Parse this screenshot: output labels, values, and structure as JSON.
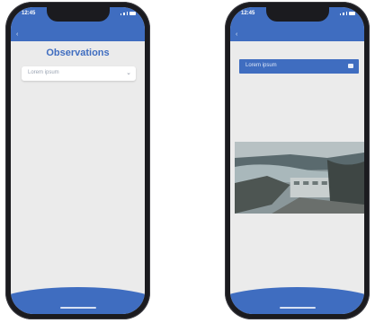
{
  "left_screen": {
    "status_time": "12:45",
    "title": "Observations",
    "select_value": "Lorem ipsum",
    "chevron_icon": "chevron-down-icon"
  },
  "right_screen": {
    "status_time": "12:45",
    "select_value": "Lorem ipsum",
    "calendar_icon": "calendar-icon"
  },
  "colors": {
    "primary": "#3f6dc0",
    "background": "#ebebeb",
    "device": "#1b1b1f"
  }
}
